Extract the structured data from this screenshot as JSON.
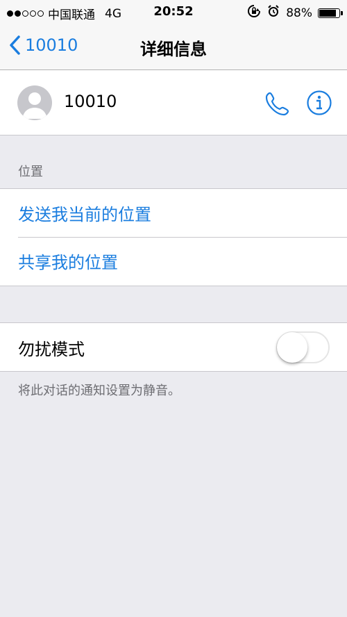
{
  "status_bar": {
    "carrier": "中国联通",
    "network": "4G",
    "time": "20:52",
    "battery_percent": "88%",
    "battery_level": 0.88,
    "signal_dots_filled": 2,
    "signal_dots_total": 5
  },
  "nav": {
    "back_label": "10010",
    "title": "详细信息"
  },
  "contact": {
    "name": "10010",
    "call_icon": "phone-icon",
    "info_icon": "info-icon"
  },
  "location": {
    "section_label": "位置",
    "items": [
      {
        "label": "发送我当前的位置"
      },
      {
        "label": "共享我的位置"
      }
    ]
  },
  "dnd": {
    "label": "勿扰模式",
    "enabled": false,
    "note": "将此对话的通知设置为静音。"
  },
  "colors": {
    "accent": "#1a7ddf",
    "background": "#ebebf0"
  }
}
